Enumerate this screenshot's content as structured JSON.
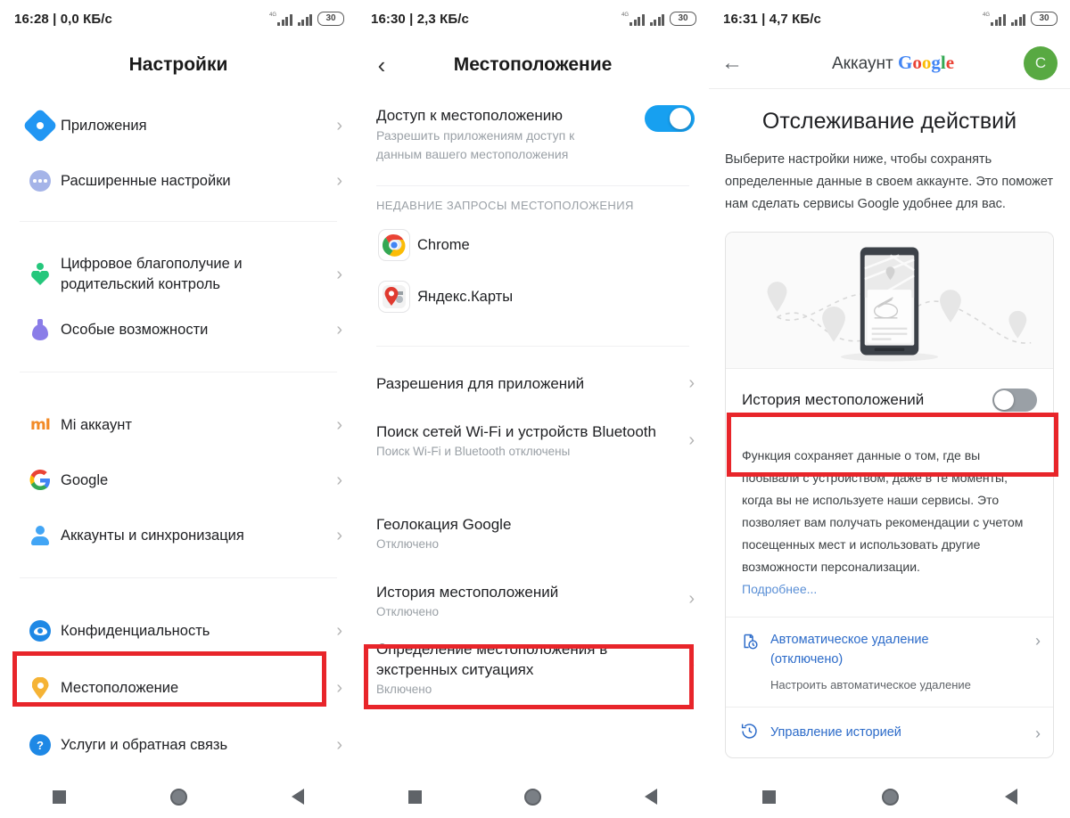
{
  "panel1": {
    "statusbar": {
      "left": "16:28 | 0,0 КБ/с",
      "network": "4G",
      "battery": "30"
    },
    "title": "Настройки",
    "items": [
      {
        "label": "Приложения",
        "icon": "gear-icon"
      },
      {
        "label": "Расширенные настройки",
        "icon": "more-dots-icon"
      },
      {
        "label": "Цифровое благополучие и\nродительский контроль",
        "icon": "heart-icon"
      },
      {
        "label": "Особые возможности",
        "icon": "accessibility-icon"
      },
      {
        "label": "Mi аккаунт",
        "icon": "mi-logo-icon"
      },
      {
        "label": "Google",
        "icon": "google-logo-icon"
      },
      {
        "label": "Аккаунты и синхронизация",
        "icon": "person-icon"
      },
      {
        "label": "Конфиденциальность",
        "icon": "eye-icon"
      },
      {
        "label": "Местоположение",
        "icon": "location-pin-icon"
      },
      {
        "label": "Услуги и обратная связь",
        "icon": "question-mark-icon"
      }
    ]
  },
  "panel2": {
    "statusbar": {
      "left": "16:30 | 2,3 КБ/с",
      "network": "4G",
      "battery": "30"
    },
    "title": "Местоположение",
    "access": {
      "label": "Доступ к местоположению",
      "sub": "Разрешить приложениям доступ к\nданным вашего местоположения",
      "toggle": "on"
    },
    "section_label": "НЕДАВНИЕ ЗАПРОСЫ МЕСТОПОЛОЖЕНИЯ",
    "apps": [
      {
        "label": "Chrome",
        "icon": "chrome-icon"
      },
      {
        "label": "Яндекс.Карты",
        "icon": "yandex-maps-icon"
      }
    ],
    "items": [
      {
        "label": "Разрешения для приложений",
        "sub": ""
      },
      {
        "label": "Поиск сетей Wi-Fi и устройств Bluetooth",
        "sub": "Поиск Wi-Fi и Bluetooth отключены"
      },
      {
        "label": "Геолокация Google",
        "sub": "Отключено"
      },
      {
        "label": "История местоположений",
        "sub": "Отключено"
      },
      {
        "label": "Определение местоположения в\nэкстренных ситуациях",
        "sub": "Включено"
      }
    ]
  },
  "panel3": {
    "statusbar": {
      "left": "16:31 | 4,7 КБ/с",
      "network": "4G",
      "battery": "30"
    },
    "header": {
      "title_prefix": "Аккаунт ",
      "title_brand": "Google",
      "avatar_letter": "С"
    },
    "heading": "Отслеживание действий",
    "intro": "Выберите настройки ниже, чтобы сохранять определенные данные в своем аккаунте. Это поможет нам сделать сервисы Google удобнее для вас.",
    "card": {
      "toggle_label": "История местоположений",
      "toggle": "off",
      "description": "Функция сохраняет данные о том, где вы побывали с устройством, даже в те моменты, когда вы не используете наши сервисы. Это позволяет вам получать рекомендации с учетом посещенных мест и использовать другие возможности персонализации. ",
      "more_link": "Подробнее...",
      "actions": [
        {
          "label": "Автоматическое удаление\n(отключено)",
          "sub": "Настроить автоматическое удаление",
          "icon": "auto-delete-icon"
        },
        {
          "label": "Управление историей",
          "sub": "",
          "icon": "history-clock-icon"
        }
      ]
    }
  },
  "navbar": {
    "recents": "recents-square-icon",
    "home": "home-circle-icon",
    "back": "back-triangle-icon"
  },
  "colors": {
    "highlight": "#e8252a",
    "accent_blue": "#1a73e8",
    "toggle_on": "#17a0f0"
  }
}
